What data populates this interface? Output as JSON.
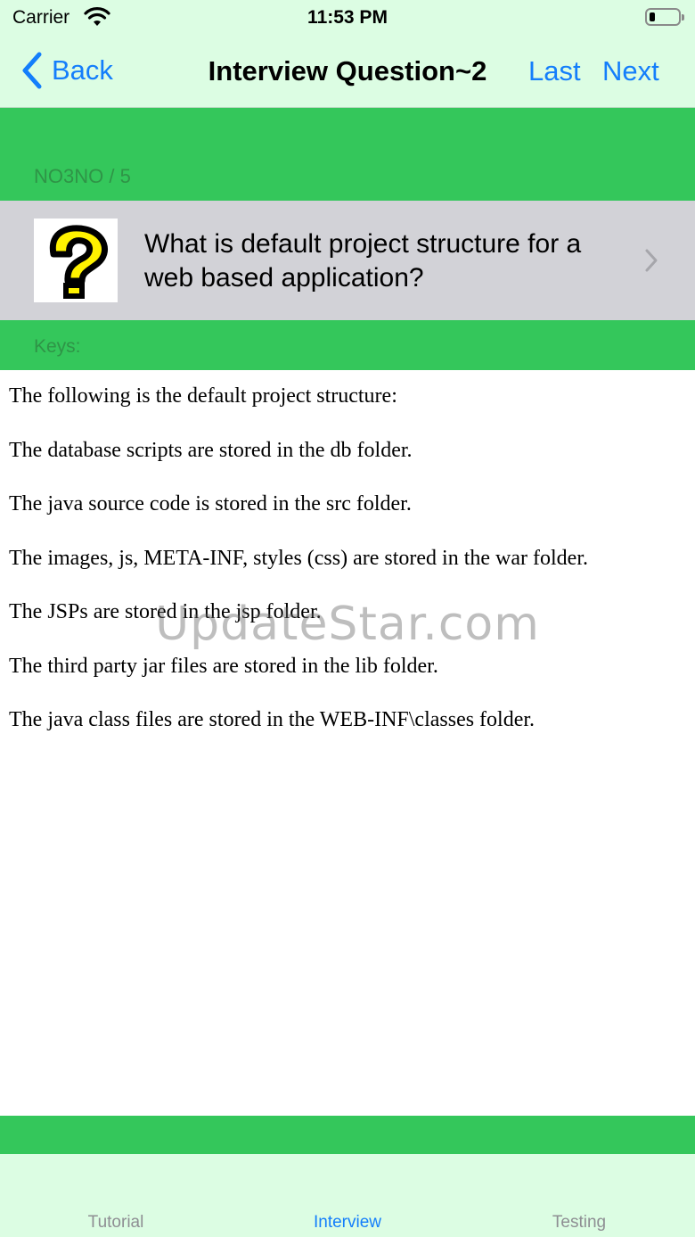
{
  "status_bar": {
    "carrier": "Carrier",
    "time": "11:53 PM",
    "battery_level_percent": 10
  },
  "nav": {
    "back_label": "Back",
    "title": "Interview Question~2",
    "last_label": "Last",
    "next_label": "Next"
  },
  "header": {
    "counter": "NO3NO / 5"
  },
  "question": {
    "text": "What is default project structure for a web based application?",
    "icon": "question-mark-icon"
  },
  "keys": {
    "label": "Keys:"
  },
  "answer": {
    "paragraphs": [
      "The following is the default project structure:",
      "The database scripts are stored in the db folder.",
      "The java source code is stored in the src folder.",
      "The images, js, META-INF, styles (css) are stored in the war folder.",
      "The JSPs are stored in the jsp folder.",
      "The third party jar files are stored in the lib folder.",
      "The java class files are stored in the WEB-INF\\classes folder."
    ]
  },
  "watermark": "UpdateStar.com",
  "tabs": [
    {
      "label": "Tutorial",
      "active": false
    },
    {
      "label": "Interview",
      "active": true
    },
    {
      "label": "Testing",
      "active": false
    }
  ],
  "colors": {
    "accent_blue": "#147efb",
    "green_band": "#34c75b",
    "mint_bar": "#dcfde3",
    "question_row": "#d2d2d7",
    "inactive_tab": "#8e8e93"
  }
}
